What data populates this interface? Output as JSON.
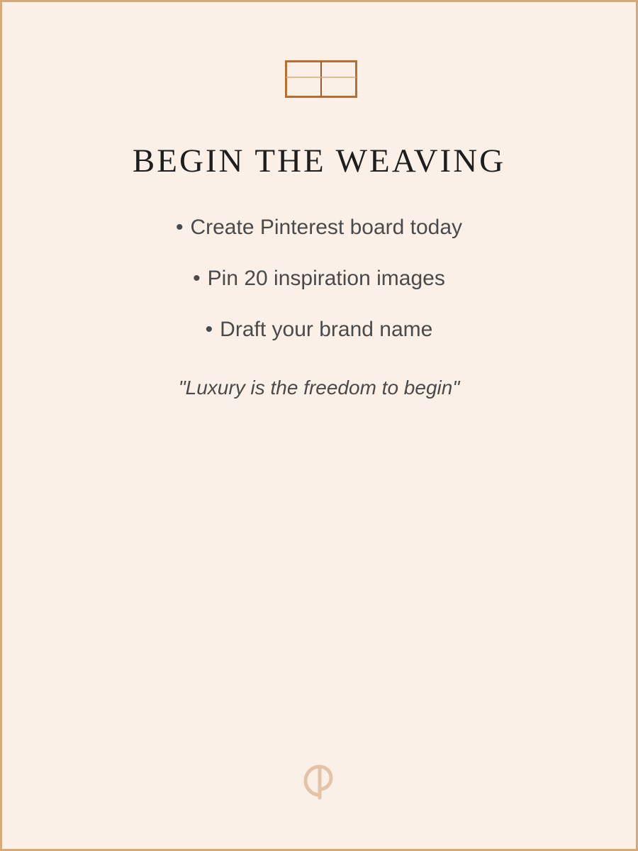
{
  "page": {
    "title": "BEGIN THE WEAVING",
    "checklist": [
      {
        "bullet": "•",
        "text": "Create Pinterest board today"
      },
      {
        "bullet": "•",
        "text": "Pin 20 inspiration images"
      },
      {
        "bullet": "•",
        "text": "Draft your brand name"
      }
    ],
    "quote": "\"Luxury is the freedom to begin\""
  },
  "icons": {
    "top": "loom-frame-icon",
    "footer": "monogram-logo"
  },
  "colors": {
    "background": "#faf0e7",
    "border": "#d9a877",
    "accent": "#b86e30",
    "monogram": "#e4c4a8",
    "title": "#1e1e1e",
    "body_text": "#4a4a4a"
  }
}
